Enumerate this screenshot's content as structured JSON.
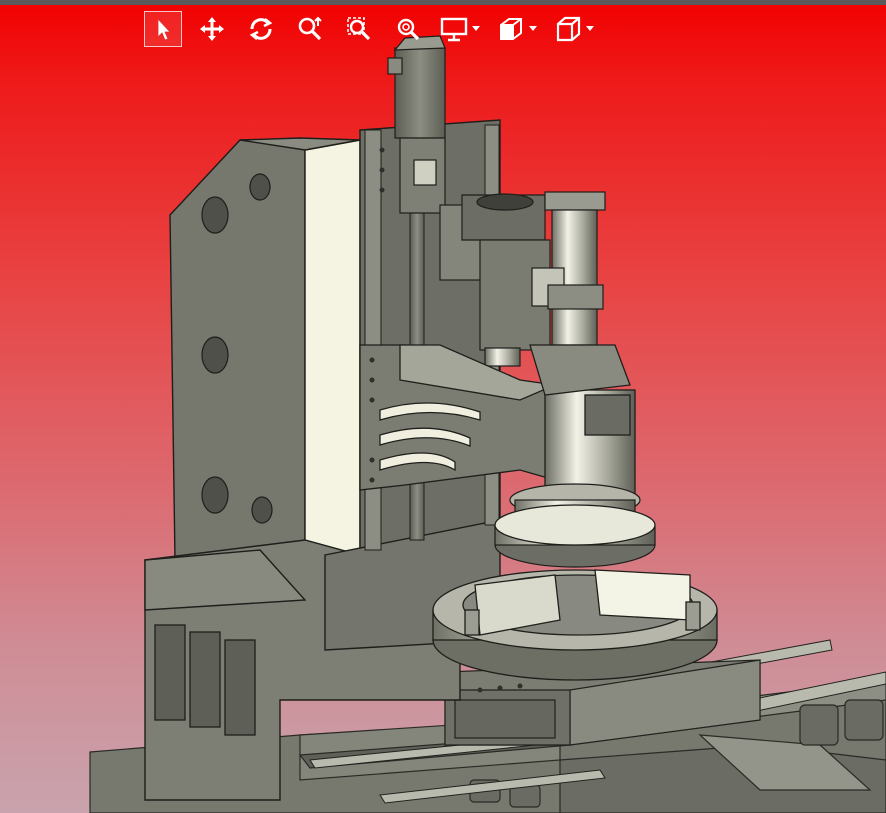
{
  "viewer": {
    "background_top": "#f20000",
    "background_bottom": "#c9a3ad",
    "model_color": "#7c7d72",
    "model_highlight": "#f3f3e4"
  },
  "toolbar": {
    "tools": [
      {
        "name": "select-tool",
        "icon": "cursor-arrow-icon",
        "selected": true
      },
      {
        "name": "pan-tool",
        "icon": "move-arrows-icon"
      },
      {
        "name": "rotate-tool",
        "icon": "rotate-icon"
      },
      {
        "name": "zoom-tool",
        "icon": "zoom-icon"
      },
      {
        "name": "zoom-window-tool",
        "icon": "zoom-window-icon"
      },
      {
        "name": "zoom-fit-tool",
        "icon": "zoom-fit-icon"
      },
      {
        "name": "display-mode-dropdown",
        "icon": "monitor-icon",
        "dropdown": true
      },
      {
        "name": "section-view-dropdown",
        "icon": "section-cube-icon",
        "dropdown": true
      },
      {
        "name": "view-orientation-dropdown",
        "icon": "cube-icon",
        "dropdown": true
      }
    ]
  }
}
